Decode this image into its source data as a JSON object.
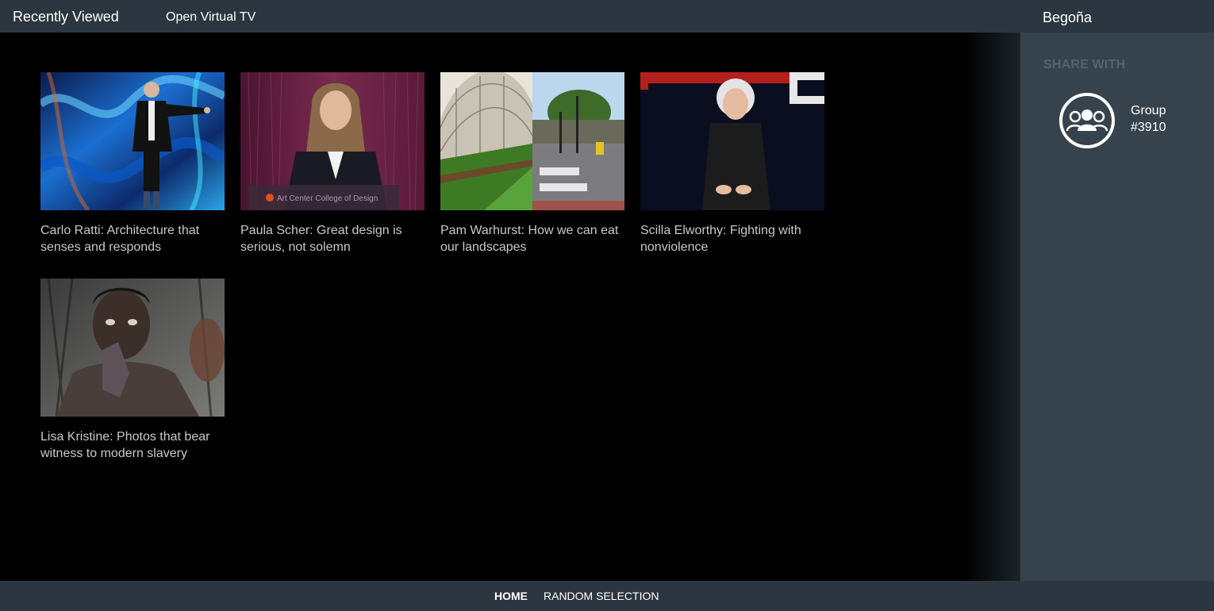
{
  "header": {
    "title": "Recently Viewed",
    "open_tv_link": "Open Virtual TV",
    "user_name": "Begoña"
  },
  "videos": [
    {
      "title": "Carlo Ratti: Architecture that senses and responds"
    },
    {
      "title": "Paula Scher: Great design is serious, not solemn"
    },
    {
      "title": "Pam Warhurst: How we can eat our landscapes"
    },
    {
      "title": "Scilla Elworthy: Fighting with nonviolence"
    },
    {
      "title": "Lisa Kristine: Photos that bear witness to modern slavery"
    }
  ],
  "sidebar": {
    "heading": "SHARE WITH",
    "groups": [
      {
        "name": "Group #3910",
        "icon": "group-people-icon"
      }
    ]
  },
  "footer": {
    "nav": [
      {
        "label": "HOME",
        "active": true
      },
      {
        "label": "RANDOM SELECTION",
        "active": false
      }
    ]
  },
  "colors": {
    "bar_background": "#2c3640",
    "sidebar_background": "#36424c",
    "caption_text": "#c9c9c9",
    "sidebar_heading": "#56626c"
  }
}
